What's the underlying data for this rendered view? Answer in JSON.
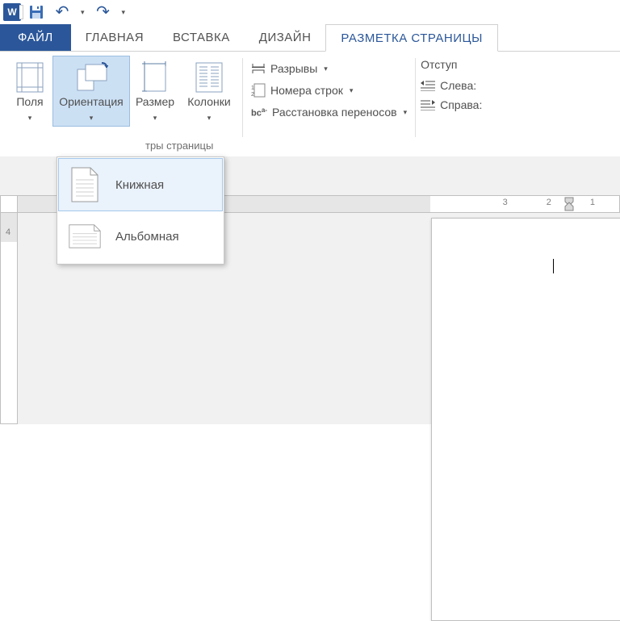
{
  "qat": {
    "app_letter": "W"
  },
  "tabs": {
    "file": "ФАЙЛ",
    "home": "ГЛАВНАЯ",
    "insert": "ВСТАВКА",
    "design": "ДИЗАЙН",
    "page_layout": "РАЗМЕТКА СТРАНИЦЫ"
  },
  "ribbon": {
    "margins": "Поля",
    "orientation": "Ориентация",
    "size": "Размер",
    "columns": "Колонки",
    "breaks": "Разрывы",
    "line_numbers": "Номера строк",
    "hyphenation": "Расстановка переносов",
    "group_label": "тры страницы",
    "indent": {
      "title": "Отступ",
      "left": "Слева:",
      "right": "Справа:"
    }
  },
  "dropdown": {
    "portrait": "Книжная",
    "landscape": "Альбомная"
  },
  "ruler": {
    "h": [
      "3",
      "2",
      "1"
    ],
    "v4": "4"
  }
}
